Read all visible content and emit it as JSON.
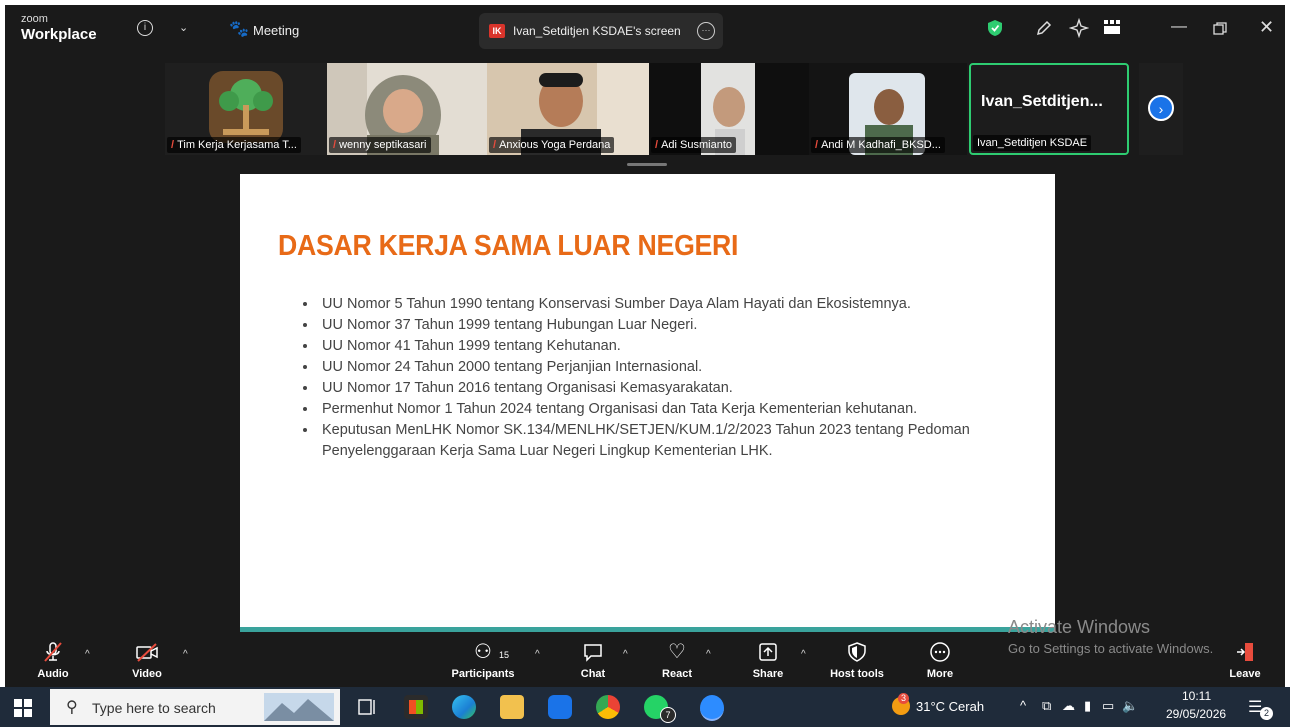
{
  "app": {
    "brand_small": "zoom",
    "brand_big": "Workplace",
    "meeting_label": "Meeting"
  },
  "share_tab": {
    "badge": "IK",
    "label": "Ivan_Setditjen KSDAE's screen"
  },
  "participants": [
    {
      "name": "Tim Kerja Kerjasama T..."
    },
    {
      "name": "wenny septikasari"
    },
    {
      "name": "Anxious Yoga Perdana"
    },
    {
      "name": "Adi Susmianto"
    },
    {
      "name": "Andi M Kadhafi_BKSD..."
    },
    {
      "name": "Ivan_Setditjen KSDAE",
      "display": "Ivan_Setditjen..."
    }
  ],
  "slide": {
    "title": "DASAR KERJA SAMA LUAR NEGERI",
    "bullets": [
      "UU Nomor 5 Tahun 1990 tentang Konservasi Sumber Daya Alam Hayati dan Ekosistemnya.",
      "UU Nomor 37 Tahun 1999 tentang Hubungan Luar Negeri.",
      "UU Nomor 41 Tahun 1999 tentang Kehutanan.",
      "UU Nomor 24 Tahun 2000 tentang Perjanjian Internasional.",
      "UU Nomor 17 Tahun 2016 tentang Organisasi Kemasyarakatan.",
      "Permenhut Nomor 1 Tahun 2024 tentang Organisasi dan Tata Kerja Kementerian kehutanan.",
      "Keputusan MenLHK Nomor SK.134/MENLHK/SETJEN/KUM.1/2/2023 Tahun 2023 tentang Pedoman Penyelenggaraan Kerja Sama Luar Negeri Lingkup Kementerian LHK."
    ]
  },
  "watermark": {
    "line1": "Activate Windows",
    "line2": "Go to Settings to activate Windows."
  },
  "toolbar": {
    "audio": "Audio",
    "video": "Video",
    "participants": "Participants",
    "participants_count": "15",
    "chat": "Chat",
    "react": "React",
    "share": "Share",
    "host_tools": "Host tools",
    "more": "More",
    "leave": "Leave"
  },
  "taskbar": {
    "search_placeholder": "Type here to search",
    "whatsapp_badge": "7",
    "weather": "31°C  Cerah",
    "weather_badge": "3",
    "time": "10:11",
    "date": "29/05/2026",
    "notif_badge": "2"
  },
  "colors": {
    "slide_title": "#e86a17",
    "active_speaker": "#2ecc71",
    "accent_blue": "#1a73e8"
  }
}
